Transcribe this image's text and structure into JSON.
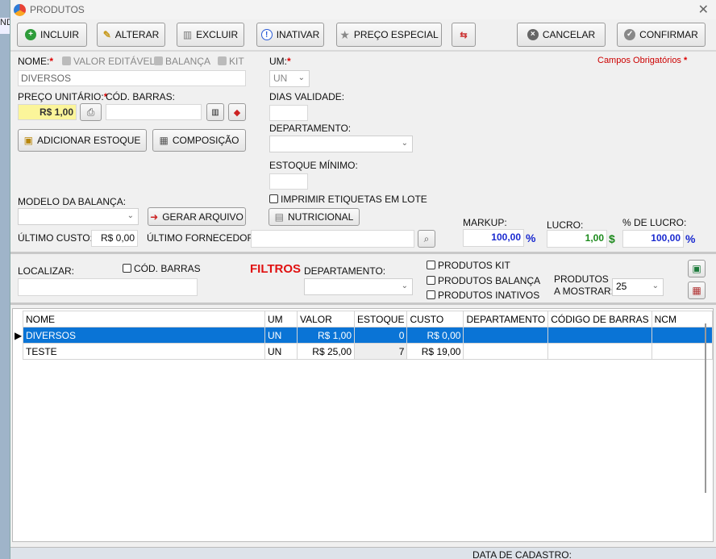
{
  "bg_stub": "ND",
  "window": {
    "title": "PRODUTOS",
    "close": "✕"
  },
  "toolbar": {
    "incluir": "INCLUIR",
    "alterar": "ALTERAR",
    "excluir": "EXCLUIR",
    "inativar": "INATIVAR",
    "preco_especial": "PREÇO ESPECIAL",
    "cancelar": "CANCELAR",
    "confirmar": "CONFIRMAR"
  },
  "form": {
    "nome_label": "NOME:",
    "valor_editavel": "VALOR EDITÁVEL",
    "balanca": "BALANÇA",
    "kit": "KIT",
    "nome_value": "DIVERSOS",
    "um_label": "UM:",
    "um_value": "UN",
    "campos_obrigatorios": "Campos Obrigatórios",
    "preco_label": "PREÇO UNITÁRIO:",
    "preco_value": "R$ 1,00",
    "cod_barras_label": "CÓD. BARRAS:",
    "dias_validade_label": "DIAS VALIDADE:",
    "adicionar_estoque": "ADICIONAR ESTOQUE",
    "composicao": "COMPOSIÇÃO",
    "departamento_label": "DEPARTAMENTO:",
    "estoque_minimo_label": "ESTOQUE MÍNIMO:",
    "modelo_balanca_label": "MODELO DA BALANÇA:",
    "gerar_arquivo": "GERAR ARQUIVO",
    "imprimir_etiquetas": "IMPRIMIR ETIQUETAS EM LOTE",
    "nutricional": "NUTRICIONAL",
    "ultimo_custo_label": "ÚLTIMO CUSTO:",
    "ultimo_custo_value": "R$ 0,00",
    "ultimo_fornecedor_label": "ÚLTIMO FORNECEDOR:",
    "markup_label": "MARKUP:",
    "markup_value": "100,00",
    "markup_unit": "%",
    "lucro_label": "LUCRO:",
    "lucro_value": "1,00",
    "lucro_unit": "$",
    "pct_lucro_label": "% DE LUCRO:",
    "pct_lucro_value": "100,00",
    "pct_lucro_unit": "%",
    "asterisk": "*"
  },
  "filters": {
    "localizar_label": "LOCALIZAR:",
    "cod_barras": "CÓD. BARRAS",
    "filtros_title": "FILTROS",
    "departamento_label": "DEPARTAMENTO:",
    "produtos_kit": "PRODUTOS KIT",
    "produtos_balanca": "PRODUTOS BALANÇA",
    "produtos_inativos": "PRODUTOS INATIVOS",
    "produtos_mostrar_1": "PRODUTOS",
    "produtos_mostrar_2": "A MOSTRAR:",
    "mostrar_value": "25"
  },
  "table": {
    "headers": [
      "NOME",
      "UM",
      "VALOR",
      "ESTOQUE",
      "CUSTO",
      "DEPARTAMENTO",
      "CÓDIGO DE BARRAS",
      "NCM"
    ],
    "rows": [
      [
        "DIVERSOS",
        "UN",
        "R$ 1,00",
        "0",
        "R$ 0,00",
        "",
        "",
        ""
      ],
      [
        "TESTE",
        "UN",
        "R$ 25,00",
        "7",
        "R$ 19,00",
        "",
        "",
        ""
      ]
    ]
  },
  "footer": {
    "data_cadastro": "DATA DE CADASTRO:"
  }
}
